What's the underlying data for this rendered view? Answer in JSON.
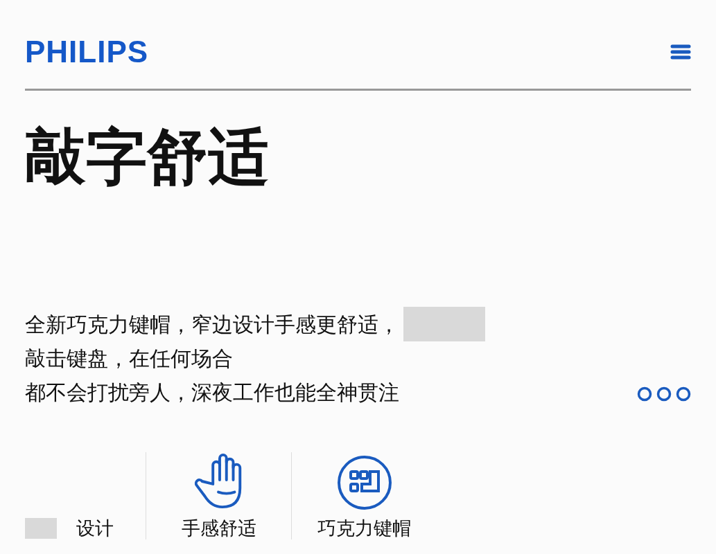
{
  "header": {
    "logo": "PHILIPS"
  },
  "title": "敲字舒适",
  "description": [
    {
      "text": "全新巧克力键帽，窄边设计手感更舒适，",
      "redacted": true
    },
    {
      "text": "敲击键盘，在任何场合",
      "redacted": false
    },
    {
      "text": "都不会打扰旁人，深夜工作也能全神贯注",
      "redacted": false
    }
  ],
  "features": [
    {
      "kind": "redacted",
      "label": "设计"
    },
    {
      "kind": "hand",
      "label": "手感舒适"
    },
    {
      "kind": "keycap",
      "label": "巧克力键帽"
    }
  ]
}
